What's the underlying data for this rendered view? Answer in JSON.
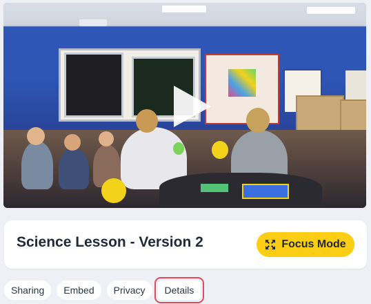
{
  "video": {
    "play_icon": "play-icon"
  },
  "lesson": {
    "title": "Science Lesson - Version 2"
  },
  "focus_mode": {
    "label": "Focus Mode",
    "icon": "expand-arrows-icon",
    "color": "#fbcd14"
  },
  "tabs": [
    {
      "label": "Sharing"
    },
    {
      "label": "Embed"
    },
    {
      "label": "Privacy"
    },
    {
      "label": "Details",
      "selected": true
    }
  ],
  "highlight_color": "#e04a5a"
}
